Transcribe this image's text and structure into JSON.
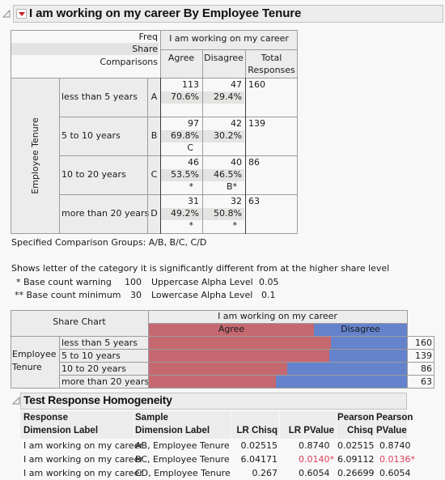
{
  "report": {
    "title": "I am working on my career By Employee Tenure",
    "crosstab": {
      "stat_labels": [
        "Freq",
        "Share",
        "Comparisons"
      ],
      "response_title": "I am working on my career",
      "columns": [
        "Agree",
        "Disagree"
      ],
      "total_label_line1": "Total",
      "total_label_line2": "Responses",
      "group_label": "Employee Tenure",
      "rows": [
        {
          "label": "less than 5 years",
          "letter": "A",
          "agree_freq": "113",
          "agree_share": "70.6%",
          "agree_cmp": "",
          "disagree_freq": "47",
          "disagree_share": "29.4%",
          "disagree_cmp": "",
          "total": "160"
        },
        {
          "label": "5 to 10 years",
          "letter": "B",
          "agree_freq": "97",
          "agree_share": "69.8%",
          "agree_cmp": "C",
          "disagree_freq": "42",
          "disagree_share": "30.2%",
          "disagree_cmp": "",
          "total": "139"
        },
        {
          "label": "10 to 20 years",
          "letter": "C",
          "agree_freq": "46",
          "agree_share": "53.5%",
          "agree_cmp": "*",
          "disagree_freq": "40",
          "disagree_share": "46.5%",
          "disagree_cmp": "B*",
          "total": "86"
        },
        {
          "label": "more than 20 years",
          "letter": "D",
          "agree_freq": "31",
          "agree_share": "49.2%",
          "agree_cmp": "*",
          "disagree_freq": "32",
          "disagree_share": "50.8%",
          "disagree_cmp": "*",
          "total": "63"
        }
      ]
    },
    "notes": {
      "comparison_groups": "Specified Comparison Groups: A/B, B/C, C/D",
      "shows_letter": "Shows letter of the category it is significantly different from at the higher share level",
      "base_warning_label": "* Base count warning",
      "base_warning_value": "100",
      "upper_alpha_label": "Uppercase Alpha Level",
      "upper_alpha_value": "0.05",
      "base_min_label": "** Base count minimum",
      "base_min_value": "30",
      "lower_alpha_label": "Lowercase Alpha Level",
      "lower_alpha_value": "0.1"
    },
    "share_chart": {
      "title": "Share Chart",
      "response_title": "I am working on my career",
      "group_label_line1": "Employee",
      "group_label_line2": "Tenure",
      "legend": [
        {
          "label": "Agree",
          "color": "#c66870"
        },
        {
          "label": "Disagree",
          "color": "#6483cc"
        }
      ]
    },
    "homogeneity": {
      "title": "Test Response Homogeneity",
      "headers": [
        [
          "Response",
          "Dimension Label"
        ],
        [
          "Sample",
          "Dimension Label"
        ],
        [
          "",
          "LR Chisq"
        ],
        [
          "",
          "LR PValue"
        ],
        [
          "Pearson",
          "Chisq"
        ],
        [
          "Pearson",
          "PValue"
        ]
      ],
      "rows": [
        {
          "response": "I am working on my career",
          "sample": "AB, Employee Tenure",
          "lr_chisq": "0.02515",
          "lr_p": "0.8740",
          "lr_p_sig": false,
          "p_chisq": "0.02515",
          "p_p": "0.8740",
          "p_p_sig": false
        },
        {
          "response": "I am working on my career",
          "sample": "BC, Employee Tenure",
          "lr_chisq": "6.04171",
          "lr_p": "0.0140*",
          "lr_p_sig": true,
          "p_chisq": "6.09112",
          "p_p": "0.0136*",
          "p_p_sig": true
        },
        {
          "response": "I am working on my career",
          "sample": "CD, Employee Tenure",
          "lr_chisq": "0.267",
          "lr_p": "0.6054",
          "lr_p_sig": false,
          "p_chisq": "0.26699",
          "p_p": "0.6054",
          "p_p_sig": false
        }
      ],
      "significant_color": "#e0405e"
    }
  },
  "chart_data": {
    "type": "bar",
    "stacked": true,
    "orientation": "horizontal",
    "title": "Share Chart",
    "xlabel": "I am working on my career",
    "ylabel": "Employee Tenure",
    "categories": [
      "less than 5 years",
      "5 to 10 years",
      "10 to 20 years",
      "more than 20 years"
    ],
    "series": [
      {
        "name": "Agree",
        "values": [
          70.6,
          69.8,
          53.5,
          49.2
        ],
        "color": "#c66870"
      },
      {
        "name": "Disagree",
        "values": [
          29.4,
          30.2,
          46.5,
          50.8
        ],
        "color": "#6483cc"
      }
    ],
    "totals": [
      "160",
      "139",
      "86",
      "63"
    ],
    "xlim": [
      0,
      100
    ],
    "legend": "top"
  }
}
